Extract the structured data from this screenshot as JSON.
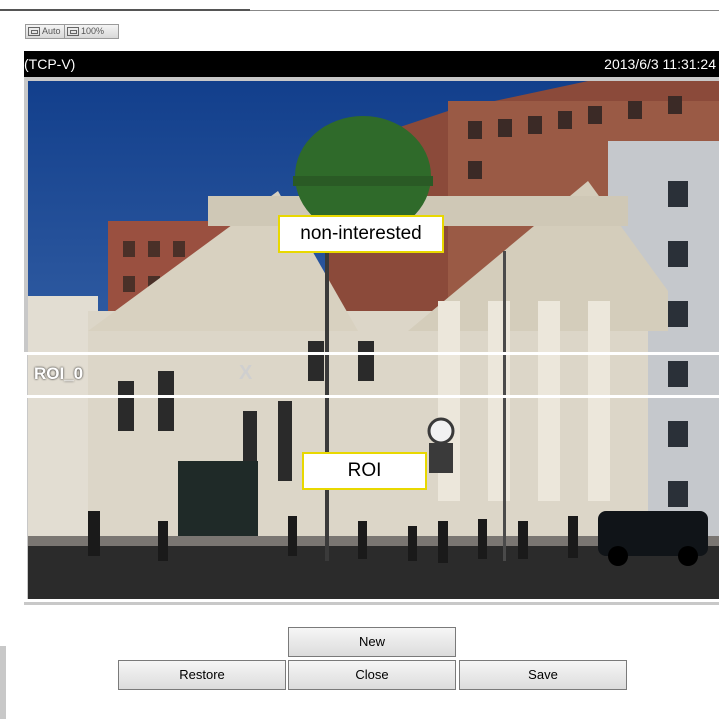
{
  "toolbar": {
    "auto_label": "Auto",
    "full_label": "100%"
  },
  "caption": {
    "protocol": "(TCP-V)",
    "timestamp": "2013/6/3 11:31:24"
  },
  "video": {
    "icons": [
      "video-frame-icon"
    ],
    "colors": {
      "sky": "#1c4fa0",
      "dome": "#2f6a2a",
      "building": "#d8d4c8",
      "brick": "#8b4a3a"
    }
  },
  "roi": {
    "name": "ROI_0",
    "close_glyph": "X",
    "label_non_interested": "non-interested",
    "label_roi": "ROI",
    "frame_color": "#ffffff",
    "label_border_color": "#e8d800"
  },
  "buttons": {
    "new": "New",
    "restore": "Restore",
    "close": "Close",
    "save": "Save"
  }
}
